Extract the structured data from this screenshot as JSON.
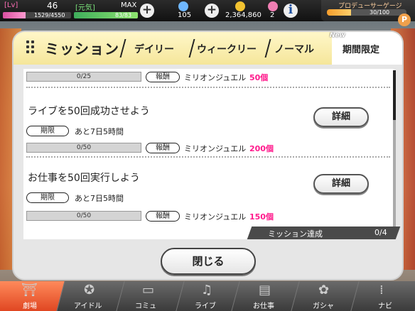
{
  "status": {
    "lv_label": "[Lv]",
    "lv_value": "46",
    "exp": "1529/4550",
    "exp_fraction": 0.336,
    "genki_label": "[元気]",
    "max_label": "MAX",
    "stamina": "83/83",
    "stamina_fraction": 1.0,
    "plus_symbol": "+",
    "currency1": "105",
    "currency2": "2,364,860",
    "currency3": "2",
    "info_symbol": "i",
    "producer_gauge_label": "プロデューサーゲージ",
    "producer_gauge_value": "30/100",
    "producer_gauge_fraction": 0.3,
    "producer_badge": "P"
  },
  "modal": {
    "title": "ミッション",
    "tabs": [
      "デイリー",
      "ウィークリー",
      "ノーマル"
    ],
    "active_tab": "期間限定",
    "new_badge": "New",
    "reward_label": "報酬",
    "term_label": "期限",
    "detail_label": "詳細",
    "missions": [
      {
        "progress": "0/25",
        "progress_fraction": 0,
        "reward_name": "ミリオンジュエル",
        "reward_amount": "50個"
      },
      {
        "title": "ライブを50回成功させよう",
        "term": "あと7日5時間",
        "progress": "0/50",
        "progress_fraction": 0,
        "reward_name": "ミリオンジュエル",
        "reward_amount": "200個"
      },
      {
        "title": "お仕事を50回実行しよう",
        "term": "あと7日5時間",
        "progress": "0/50",
        "progress_fraction": 0,
        "reward_name": "ミリオンジュエル",
        "reward_amount": "150個"
      }
    ],
    "achievement_label": "ミッション達成",
    "achievement_count": "0/4",
    "close_label": "閉じる"
  },
  "nav": {
    "items": [
      {
        "label": "劇場",
        "icon": "theater-icon"
      },
      {
        "label": "アイドル",
        "icon": "idol-icon"
      },
      {
        "label": "コミュ",
        "icon": "commu-icon"
      },
      {
        "label": "ライブ",
        "icon": "live-icon"
      },
      {
        "label": "お仕事",
        "icon": "work-icon"
      },
      {
        "label": "ガシャ",
        "icon": "gacha-icon"
      },
      {
        "label": "ナビ",
        "icon": "navi-icon"
      }
    ],
    "active_index": 0
  },
  "colors": {
    "accent_pink": "#ff1a8c",
    "tab_bar": "#f5e69a",
    "nav_active": "#e04722"
  }
}
